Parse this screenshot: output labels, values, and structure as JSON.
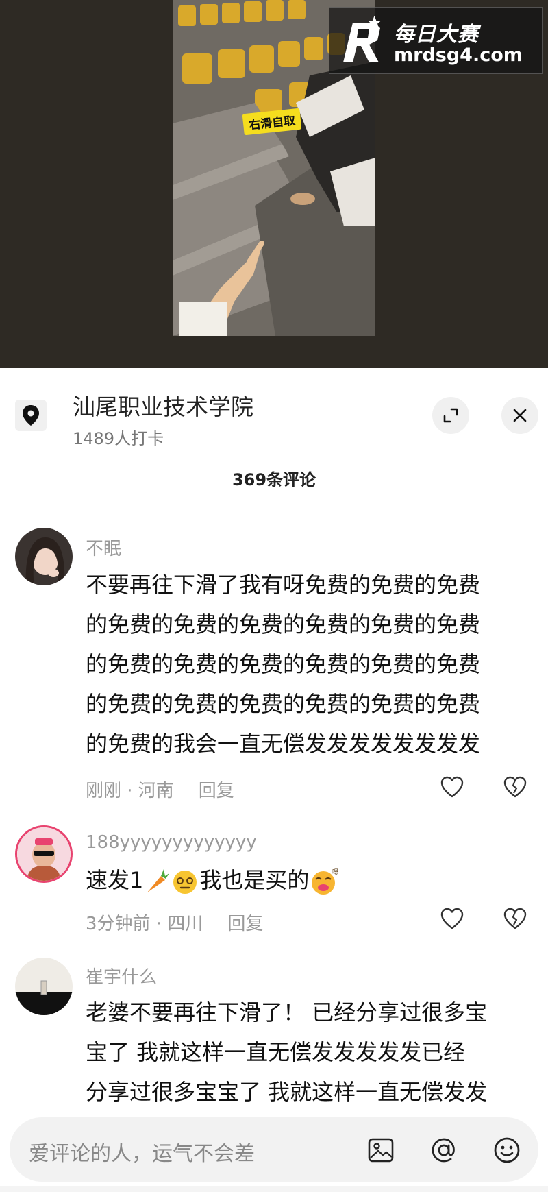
{
  "video": {
    "scene_caption": "右滑自取",
    "watermark_title": "每日大赛",
    "watermark_url": "mrdsg4.com"
  },
  "location": {
    "name": "汕尾职业技术学院",
    "checkins": "1489人打卡"
  },
  "comments_header": "369条评论",
  "comments": [
    {
      "user": "不眠",
      "lines": [
        "不要再往下滑了我有呀免费的免费的免费",
        "的免费的免费的免费的免费的免费的免费",
        "的免费的免费的免费的免费的免费的免费",
        "的免费的免费的免费的免费的免费的免费",
        "的免费的我会一直无偿发发发发发发发发"
      ],
      "time_location": "刚刚 · 河南",
      "reply": "回复"
    },
    {
      "user": "188yyyyyyyyyyyyy",
      "text_part1": "速发1",
      "text_part2": "我也是买的",
      "time_location": "3分钟前 · 四川",
      "reply": "回复"
    },
    {
      "user": "崔宇什么",
      "lines": [
        "老婆不要再往下滑了！ 已经分享过很多宝",
        "宝了 我就这样一直无偿发发发发发已经",
        "分享过很多宝宝了 我就这样一直无偿发发"
      ]
    }
  ],
  "input": {
    "placeholder": "爱评论的人，运气不会差"
  },
  "icons": {
    "location": "map-pin-icon",
    "expand": "expand-icon",
    "close": "close-icon",
    "like": "heart-icon",
    "dislike": "broken-heart-icon",
    "image": "image-icon",
    "mention": "at-icon",
    "emoji": "smiley-icon"
  }
}
